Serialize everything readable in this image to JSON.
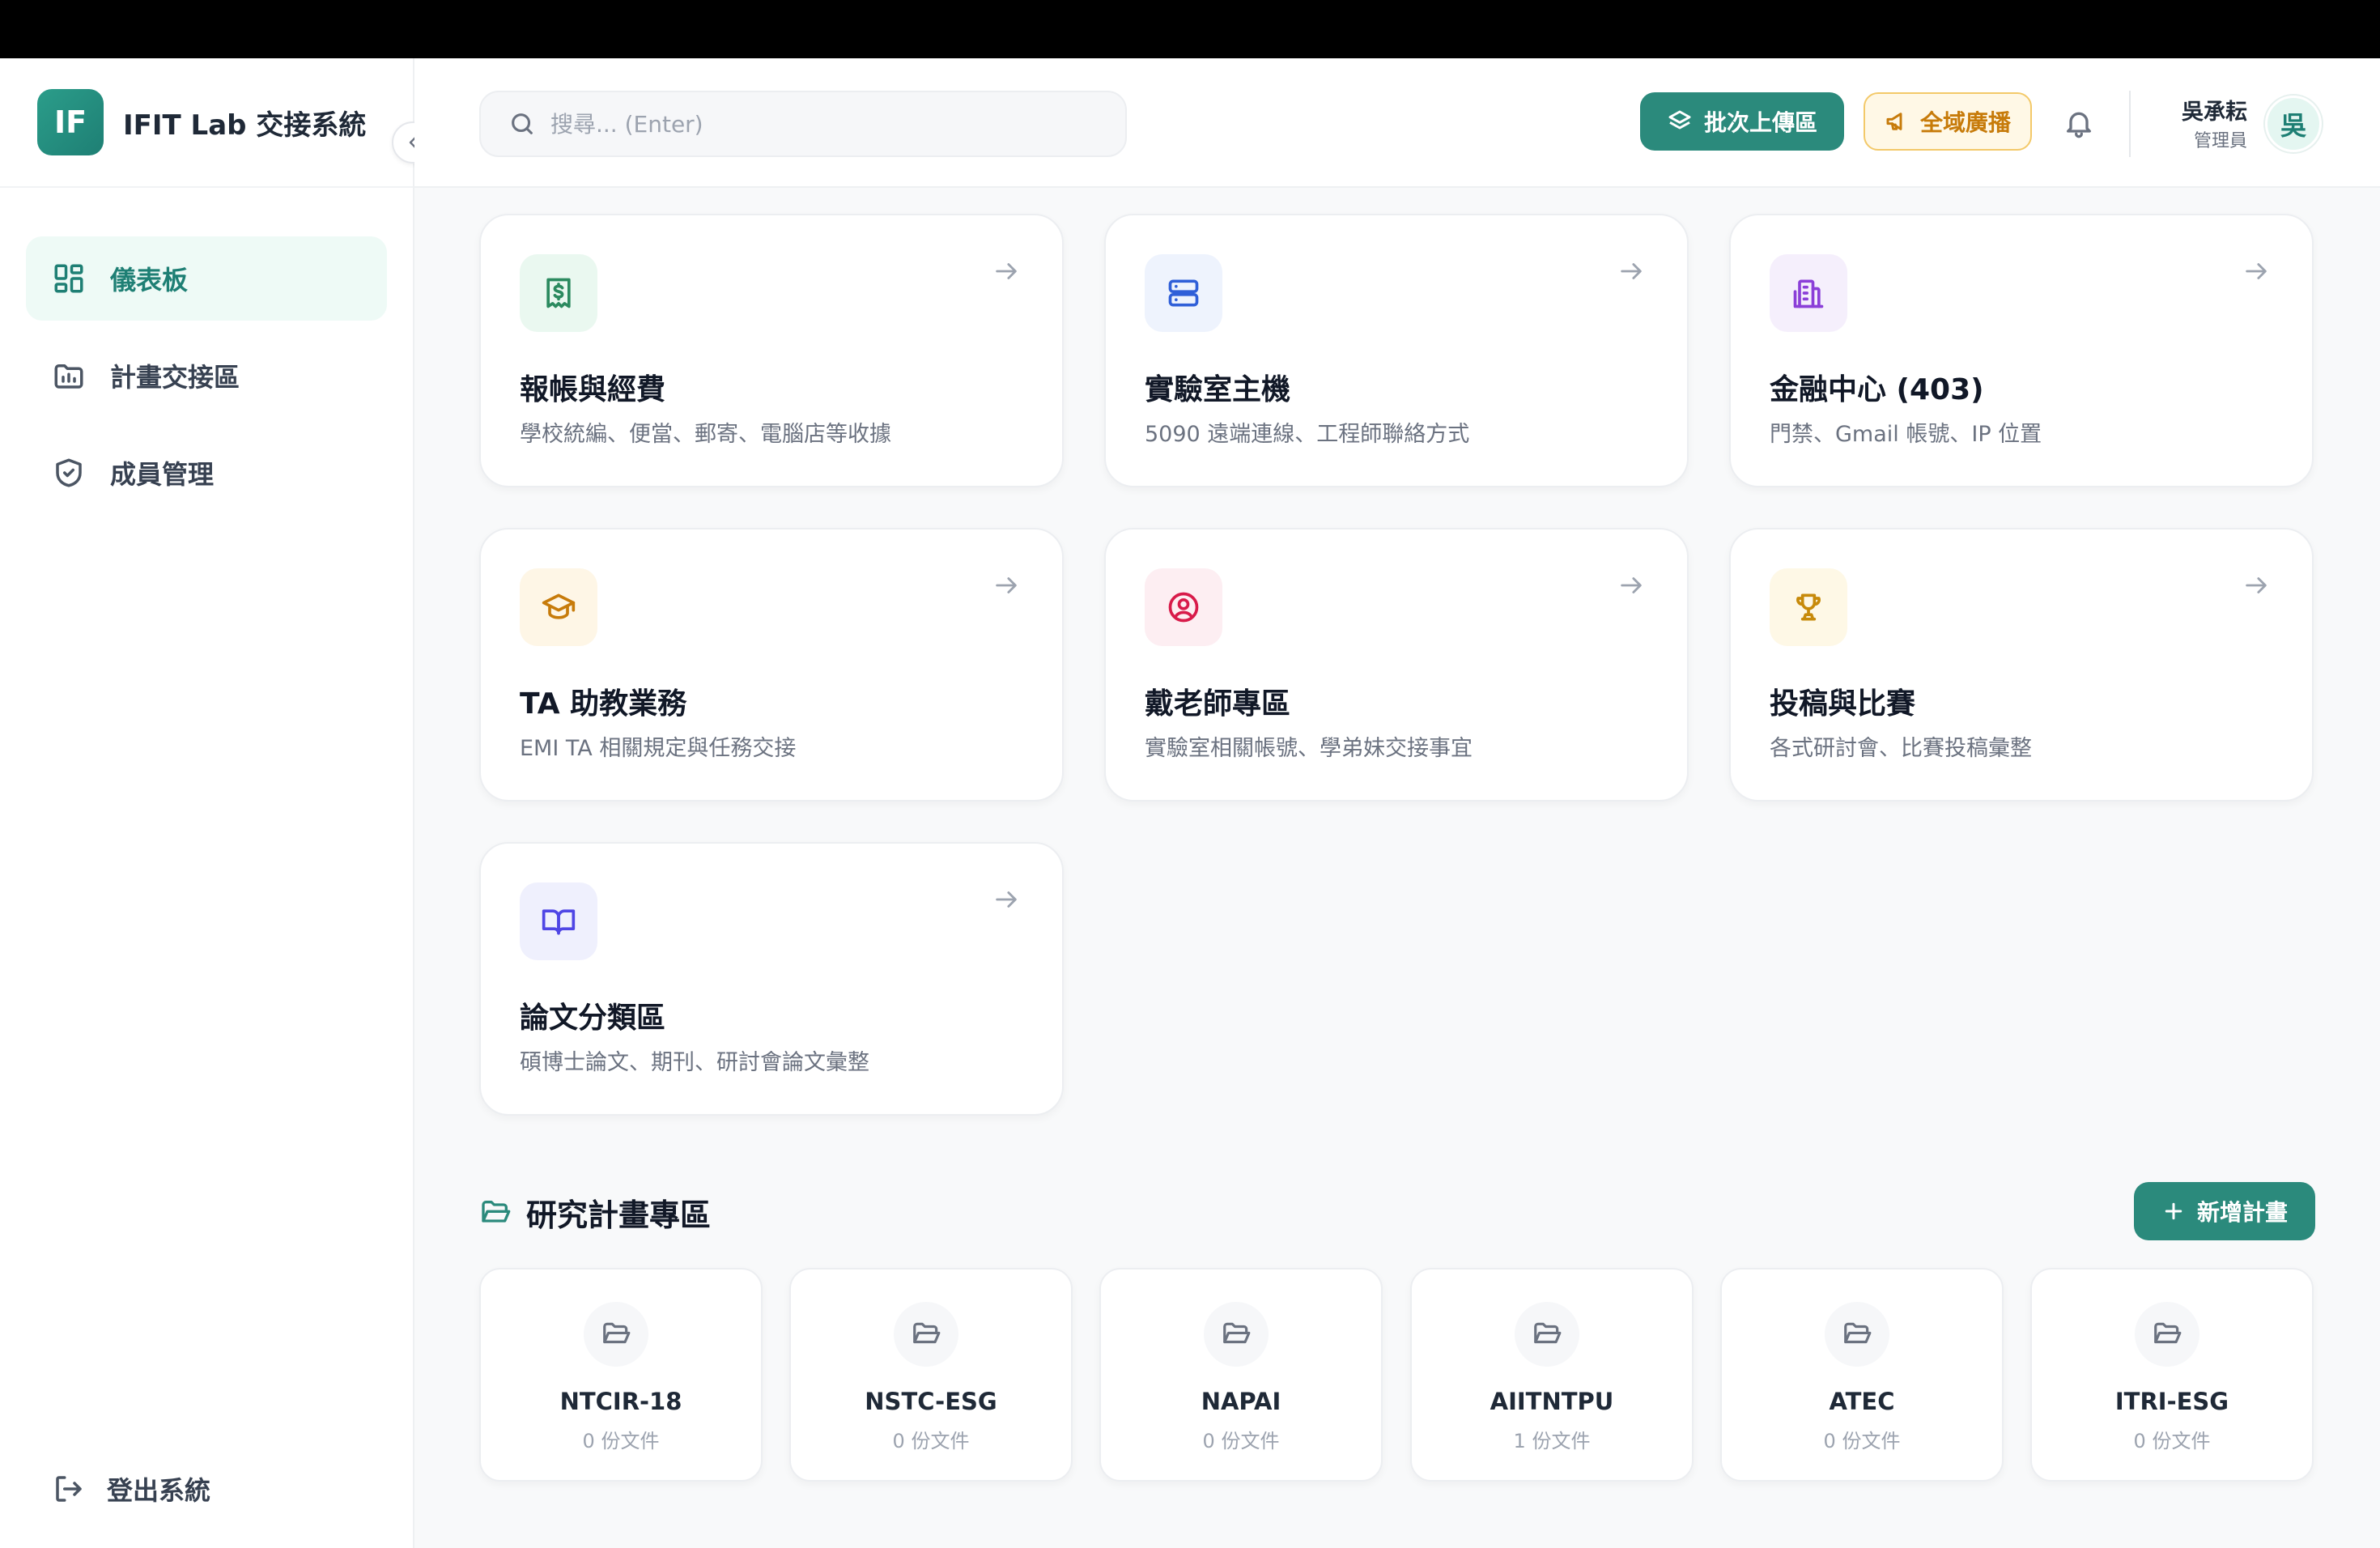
{
  "app": {
    "logo_text": "IF",
    "title": "IFIT Lab 交接系統"
  },
  "sidebar": {
    "items": [
      {
        "label": "儀表板",
        "icon": "dashboard-icon",
        "active": true
      },
      {
        "label": "計畫交接區",
        "icon": "folder-chart-icon",
        "active": false
      },
      {
        "label": "成員管理",
        "icon": "shield-check-icon",
        "active": false
      }
    ],
    "logout_label": "登出系統"
  },
  "header": {
    "search_placeholder": "搜尋... (Enter)",
    "upload_label": "批次上傳區",
    "broadcast_label": "全域廣播",
    "user_name": "吳承耘",
    "user_role": "管理員",
    "avatar_text": "吳"
  },
  "cards": [
    {
      "title": "報帳與經費",
      "desc": "學校統編、便當、郵寄、電腦店等收據",
      "icon": "receipt-dollar-icon",
      "color": "#2b8a5f",
      "bg": "#eaf8f0"
    },
    {
      "title": "實驗室主機",
      "desc": "5090 遠端連線、工程師聯絡方式",
      "icon": "server-icon",
      "color": "#2f5fd8",
      "bg": "#eef3fd"
    },
    {
      "title": "金融中心 (403)",
      "desc": "門禁、Gmail 帳號、IP 位置",
      "icon": "building-icon",
      "color": "#8b3fd8",
      "bg": "#f5effc"
    },
    {
      "title": "TA 助教業務",
      "desc": "EMI TA 相關規定與任務交接",
      "icon": "graduation-cap-icon",
      "color": "#c77b0a",
      "bg": "#fef6e6"
    },
    {
      "title": "戴老師專區",
      "desc": "實驗室相關帳號、學弟妹交接事宜",
      "icon": "user-circle-icon",
      "color": "#d81b4a",
      "bg": "#fdeef2"
    },
    {
      "title": "投稿與比賽",
      "desc": "各式研討會、比賽投稿彙整",
      "icon": "trophy-icon",
      "color": "#c78a0a",
      "bg": "#fef8e6"
    },
    {
      "title": "論文分類區",
      "desc": "碩博士論文、期刊、研討會論文彙整",
      "icon": "book-open-icon",
      "color": "#4f46e5",
      "bg": "#eff0fd"
    }
  ],
  "projects_section": {
    "title": "研究計畫專區",
    "add_label": "新增計畫",
    "projects": [
      {
        "name": "NTCIR-18",
        "count": "0 份文件"
      },
      {
        "name": "NSTC-ESG",
        "count": "0 份文件"
      },
      {
        "name": "NAPAI",
        "count": "0 份文件"
      },
      {
        "name": "AIITNTPU",
        "count": "1 份文件"
      },
      {
        "name": "ATEC",
        "count": "0 份文件"
      },
      {
        "name": "ITRI-ESG",
        "count": "0 份文件"
      }
    ]
  },
  "colors": {
    "accent": "#2b8a7c",
    "broadcast": "#c77b0a"
  }
}
